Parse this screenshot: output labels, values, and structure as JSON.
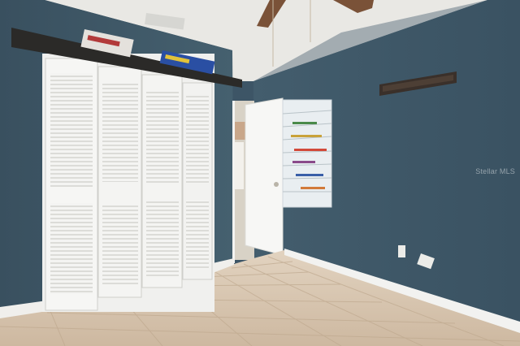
{
  "photo": {
    "subject": "",
    "watermark": "Stellar MLS"
  },
  "colors": {
    "wall": "#3e5667",
    "wall_right": "#3b5364",
    "ceiling": "#eeece8",
    "floor": "#d9c8b3",
    "trim": "#f2f2f0",
    "door": "#f7f7f5",
    "fan": "#7a5238"
  }
}
